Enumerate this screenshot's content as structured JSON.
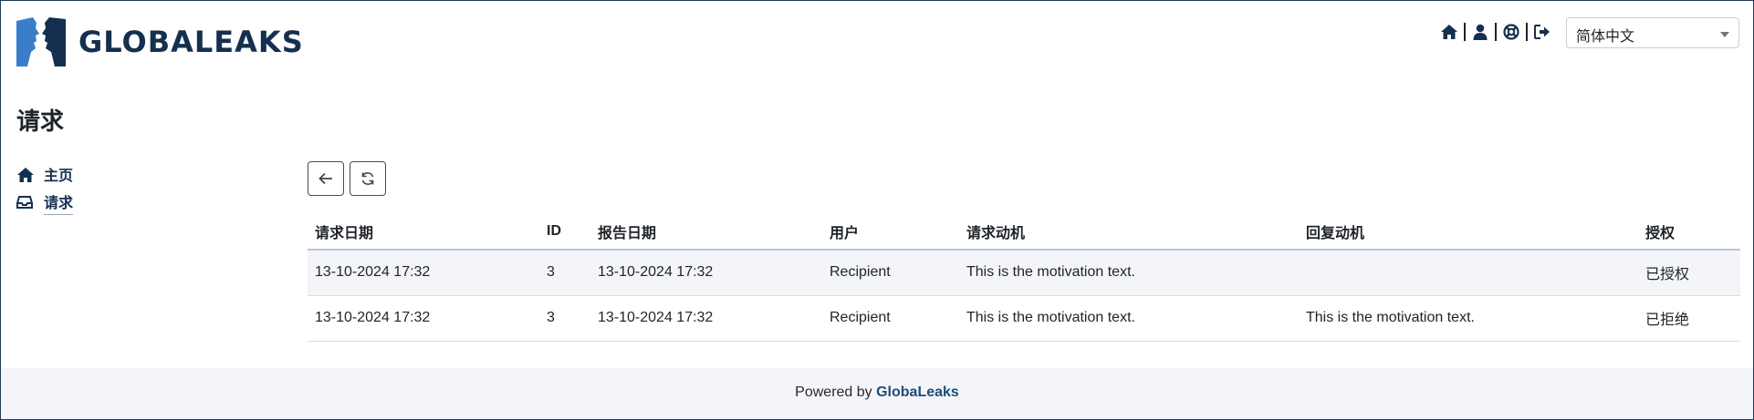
{
  "brand": {
    "name": "GLOBALEAKS"
  },
  "header": {
    "icons": [
      "home-icon",
      "user-icon",
      "lifebuoy-icon",
      "logout-icon"
    ],
    "language": "简体中文"
  },
  "page": {
    "title": "请求"
  },
  "sidebar": {
    "items": [
      {
        "label": "主页",
        "icon": "home-icon"
      },
      {
        "label": "请求",
        "icon": "inbox-icon",
        "active": true
      }
    ]
  },
  "toolbar": {
    "buttons": [
      "back-arrow-icon",
      "refresh-icon"
    ]
  },
  "table": {
    "headers": [
      "请求日期",
      "ID",
      "报告日期",
      "用户",
      "请求动机",
      "回复动机",
      "授权"
    ],
    "rows": [
      [
        "13-10-2024 17:32",
        "3",
        "13-10-2024 17:32",
        "Recipient",
        "This is the motivation text.",
        "",
        "已授权"
      ],
      [
        "13-10-2024 17:32",
        "3",
        "13-10-2024 17:32",
        "Recipient",
        "This is the motivation text.",
        "This is the motivation text.",
        "已拒绝"
      ]
    ]
  },
  "footer": {
    "prefix": "Powered by ",
    "brand": "GlobaLeaks"
  },
  "colors": {
    "brand": "#15304f",
    "accent_blue": "#3a7dc9",
    "footer_bg": "#f3f5f8"
  }
}
